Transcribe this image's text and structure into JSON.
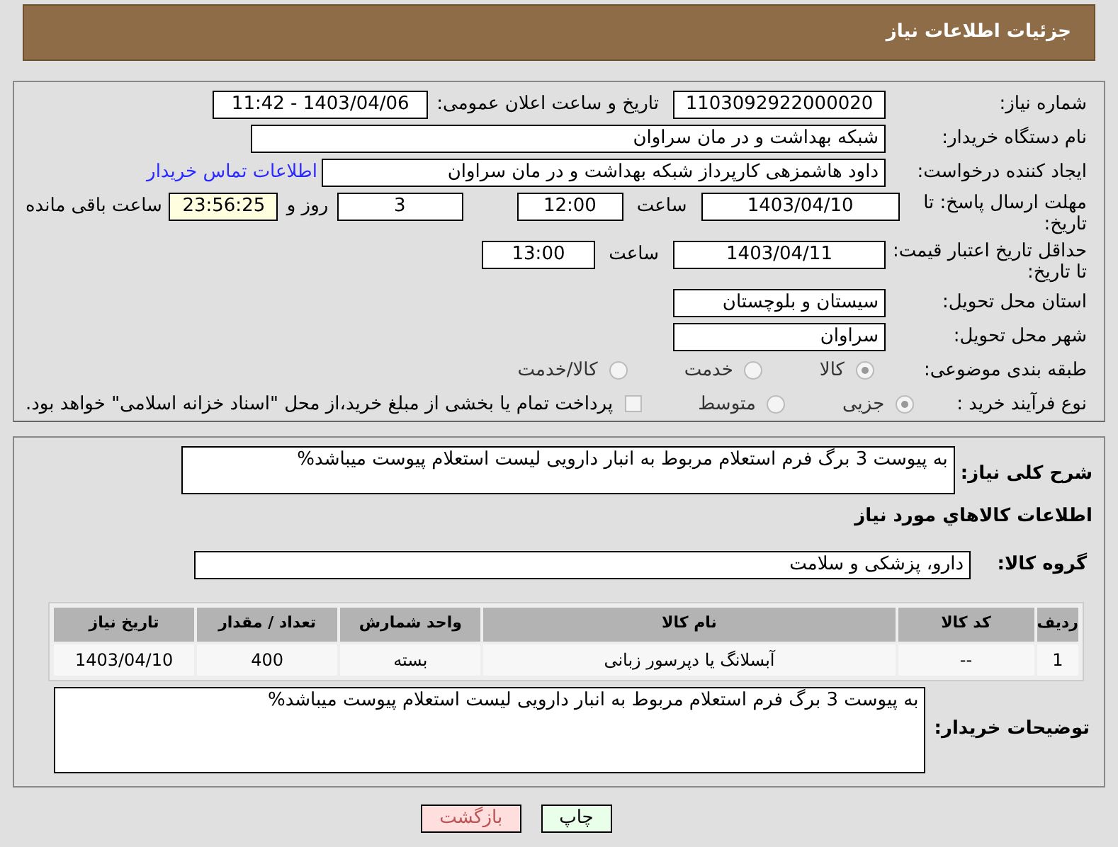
{
  "header": {
    "title": "جزئیات اطلاعات نیاز"
  },
  "need_number": {
    "label": "شماره نیاز:",
    "value": "1103092922000020"
  },
  "announce": {
    "label": "تاریخ و ساعت اعلان عمومی:",
    "value": "1403/04/06 - 11:42"
  },
  "buyer_org": {
    "label": "نام دستگاه خریدار:",
    "value": "شبکه بهداشت و در مان سراوان"
  },
  "creator": {
    "label": "ایجاد کننده درخواست:",
    "value": "داود هاشمزهی  کارپرداز شبکه بهداشت و در مان سراوان",
    "link": "اطلاعات تماس خریدار"
  },
  "reply_deadline": {
    "label": "مهلت ارسال پاسخ: تا تاریخ:",
    "date": "1403/04/10",
    "time_label": "ساعت",
    "time": "12:00",
    "days": "3",
    "days_label": "روز و",
    "remaining": "23:56:25",
    "remaining_label": "ساعت باقی مانده"
  },
  "price_validity": {
    "label": "حداقل تاریخ اعتبار قیمت: تا تاریخ:",
    "date": "1403/04/11",
    "time_label": "ساعت",
    "time": "13:00"
  },
  "province": {
    "label": "استان محل تحویل:",
    "value": "سیستان و بلوچستان"
  },
  "city": {
    "label": "شهر محل تحویل:",
    "value": "سراوان"
  },
  "category": {
    "label": "طبقه بندی موضوعی:",
    "options": [
      {
        "label": "کالا",
        "selected": true
      },
      {
        "label": "خدمت",
        "selected": false
      },
      {
        "label": "کالا/خدمت",
        "selected": false
      }
    ]
  },
  "process": {
    "label": "نوع فرآیند خرید :",
    "options": [
      {
        "label": "جزیی",
        "selected": true
      },
      {
        "label": "متوسط",
        "selected": false
      }
    ],
    "payment_checkbox": {
      "checked": false,
      "label": "پرداخت تمام یا بخشی از مبلغ خرید،از محل \"اسناد خزانه اسلامی\" خواهد بود."
    }
  },
  "description": {
    "label": "شرح کلی نیاز:",
    "value": "به پیوست 3 برگ فرم استعلام مربوط به انبار دارویی لیست استعلام پیوست میباشد%"
  },
  "goods_heading": "اطلاعات کالاهاي مورد نياز",
  "goods_group": {
    "label": "گروه کالا:",
    "value": "دارو، پزشکی و سلامت"
  },
  "table": {
    "columns": [
      "ردیف",
      "کد کالا",
      "نام کالا",
      "واحد شمارش",
      "تعداد / مقدار",
      "تاریخ نیاز"
    ],
    "rows": [
      [
        "1",
        "--",
        "آبسلانگ یا دپرسور زبانی",
        "بسته",
        "400",
        "1403/04/10"
      ]
    ]
  },
  "buyer_notes": {
    "label": "توضیحات خریدار:",
    "value": "به پیوست 3 برگ فرم استعلام مربوط به انبار دارویی لیست استعلام پیوست میباشد%"
  },
  "buttons": [
    {
      "kind": "print",
      "label": "چاپ"
    },
    {
      "kind": "back",
      "label": "بازگشت"
    }
  ]
}
